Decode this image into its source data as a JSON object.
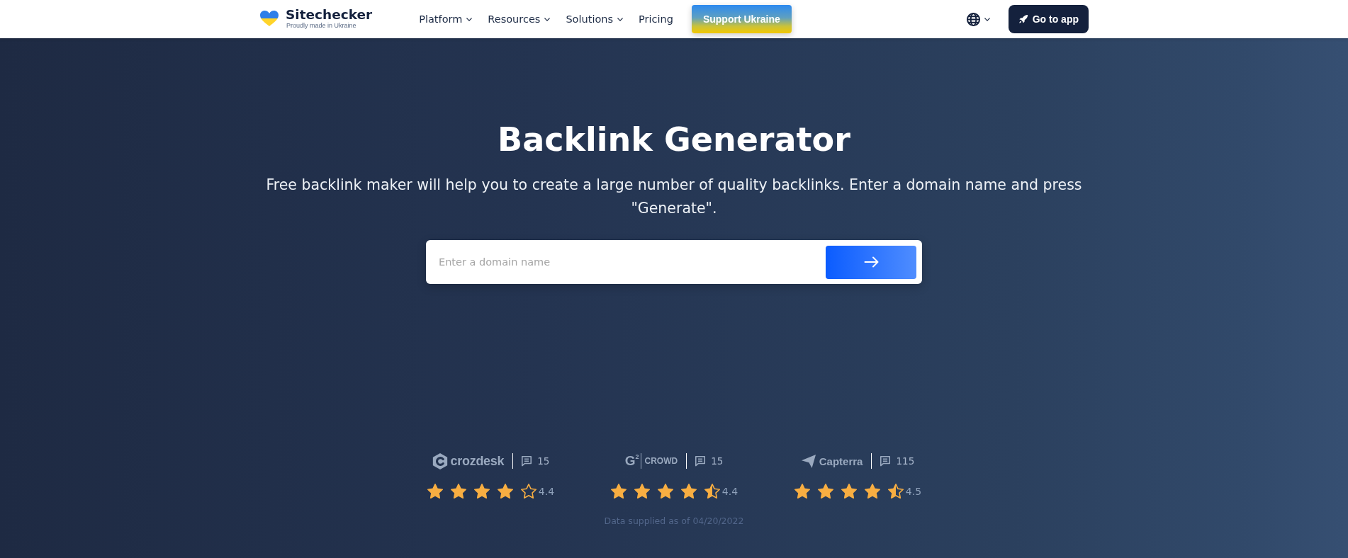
{
  "header": {
    "logo": {
      "name": "Sitechecker",
      "tagline": "Proudly made in Ukraine"
    },
    "nav": [
      {
        "label": "Platform",
        "has_menu": true
      },
      {
        "label": "Resources",
        "has_menu": true
      },
      {
        "label": "Solutions",
        "has_menu": true
      },
      {
        "label": "Pricing",
        "has_menu": false
      }
    ],
    "support_button": "Support Ukraine",
    "app_button": "Go to app"
  },
  "hero": {
    "title": "Backlink Generator",
    "subtitle": "Free backlink maker will help you to create a large number of quality backlinks. Enter a domain name and press \"Generate\".",
    "search": {
      "placeholder": "Enter a domain name"
    }
  },
  "ratings": [
    {
      "kind": "crozdesk",
      "name": "crozdesk",
      "reviews": "15",
      "stars": 4,
      "score": "4.4"
    },
    {
      "kind": "g2crowd",
      "mark": "G$^{2}$",
      "name": "CROWD",
      "reviews": "15",
      "stars": 4.5,
      "score": "4.4"
    },
    {
      "kind": "capterra",
      "name": "Capterra",
      "reviews": "115",
      "stars": 4.5,
      "score": "4.5"
    }
  ],
  "data_note": "Data supplied as of 04/20/2022"
}
